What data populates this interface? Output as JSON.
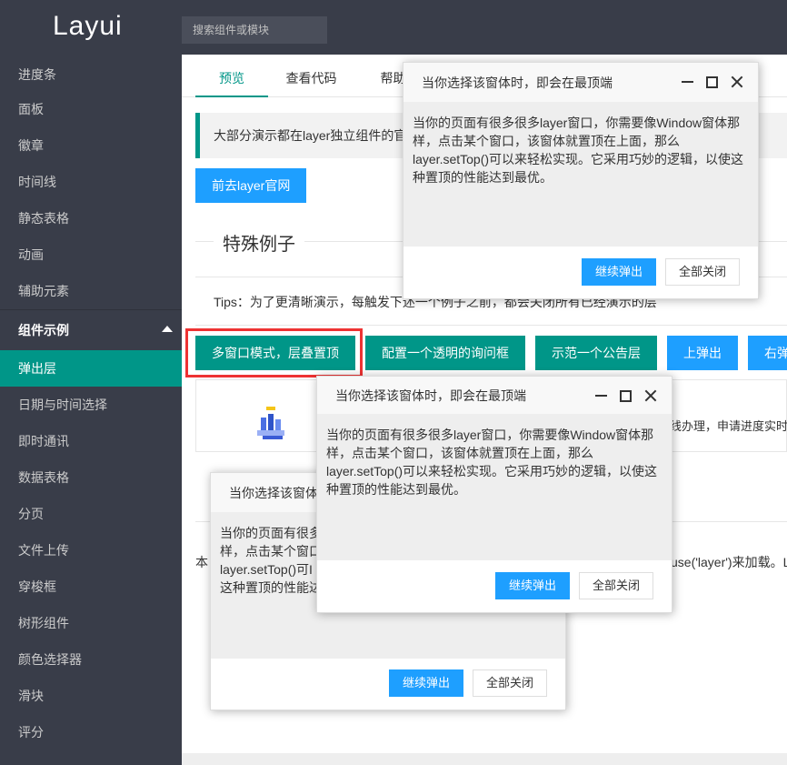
{
  "header": {
    "logo": "Layui",
    "search_placeholder": "搜索组件或模块"
  },
  "sidebar": {
    "items": [
      {
        "label": "进度条"
      },
      {
        "label": "面板"
      },
      {
        "label": "徽章"
      },
      {
        "label": "时间线"
      },
      {
        "label": "静态表格"
      },
      {
        "label": "动画"
      },
      {
        "label": "辅助元素"
      }
    ],
    "group_label": "组件示例",
    "sub_items": [
      {
        "label": "弹出层",
        "active": true
      },
      {
        "label": "日期与时间选择"
      },
      {
        "label": "即时通讯"
      },
      {
        "label": "数据表格"
      },
      {
        "label": "分页"
      },
      {
        "label": "文件上传"
      },
      {
        "label": "穿梭框"
      },
      {
        "label": "树形组件"
      },
      {
        "label": "颜色选择器"
      },
      {
        "label": "滑块"
      },
      {
        "label": "评分"
      }
    ]
  },
  "main": {
    "tabs": [
      {
        "label": "预览"
      },
      {
        "label": "查看代码"
      },
      {
        "label": "帮助"
      }
    ],
    "quote": "大部分演示都在layer独立组件的官",
    "goto_button": "前去layer官网",
    "section_title": "特殊例子",
    "tips": "Tips：为了更清晰演示，每触发下述一个例子之前，都会关闭所有已经演示的层",
    "buttons": [
      {
        "label": "多窗口模式，层叠置顶"
      },
      {
        "label": "配置一个透明的询问框"
      },
      {
        "label": "示范一个公告层"
      },
      {
        "label": "上弹出"
      },
      {
        "label": "右弹出"
      }
    ],
    "right_text": "线办理，申请进度实时",
    "body_text_left": "本",
    "body_text_right": "use('layer')来加载。L"
  },
  "layers": [
    {
      "title": "当你选择该窗体时，即会在最顶端",
      "content": "当你的页面有很多很多layer窗口，你需要像Window窗体那样，点击某个窗口，该窗体就置顶在上面，那么layer.setTop()可以来轻松实现。它采用巧妙的逻辑，以使这种置顶的性能达到最优。",
      "btn_continue": "继续弹出",
      "btn_close_all": "全部关闭"
    },
    {
      "title": "当你选择该窗体时，即会在最顶端",
      "content": "当你的页面有很多很多layer窗口，你需要像Window窗体那样，点击某个窗口，该窗体就置顶在上面，那么layer.setTop()可以来轻松实现。它采用巧妙的逻辑，以使这种置顶的性能达到最优。",
      "btn_continue": "继续弹出",
      "btn_close_all": "全部关闭"
    },
    {
      "title": "当你选择该窗体",
      "content_lines": [
        "当你的页面有很多",
        "样，点击某个窗口",
        "layer.setTop()可I",
        "这种置顶的性能达"
      ],
      "btn_continue": "继续弹出",
      "btn_close_all": "全部关闭"
    }
  ],
  "colors": {
    "sidebar_bg": "#393d49",
    "accent": "#009688",
    "primary_blue": "#1e9fff",
    "highlight_red": "#ee3333"
  }
}
